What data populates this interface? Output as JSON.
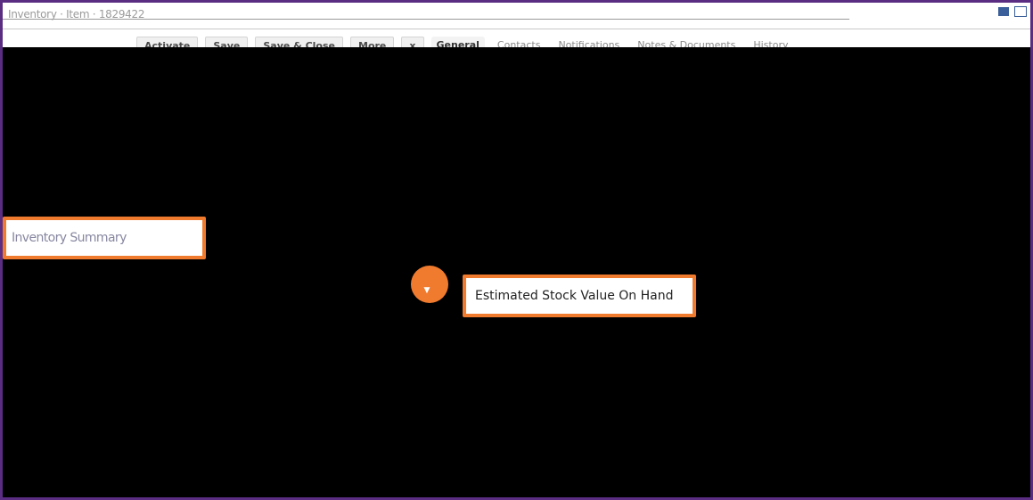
{
  "window": {
    "title": "Inventory · Item · 1829422"
  },
  "toolbar": {
    "buttons": [
      "Activate",
      "Save",
      "Save & Close",
      "More",
      "x"
    ],
    "tabs": [
      "General",
      "Contacts",
      "Notifications",
      "Notes & Documents",
      "History"
    ],
    "active_tab": "General"
  },
  "callouts": {
    "section_label": "Inventory Summary",
    "field_label": "Estimated Stock Value On Hand"
  },
  "colors": {
    "frame_border": "#5b2d82",
    "highlight": "#f07b2e",
    "overlay": "#000000"
  },
  "icons": {
    "pointer": "pointer-dot-icon",
    "caret": "caret-down-icon"
  }
}
